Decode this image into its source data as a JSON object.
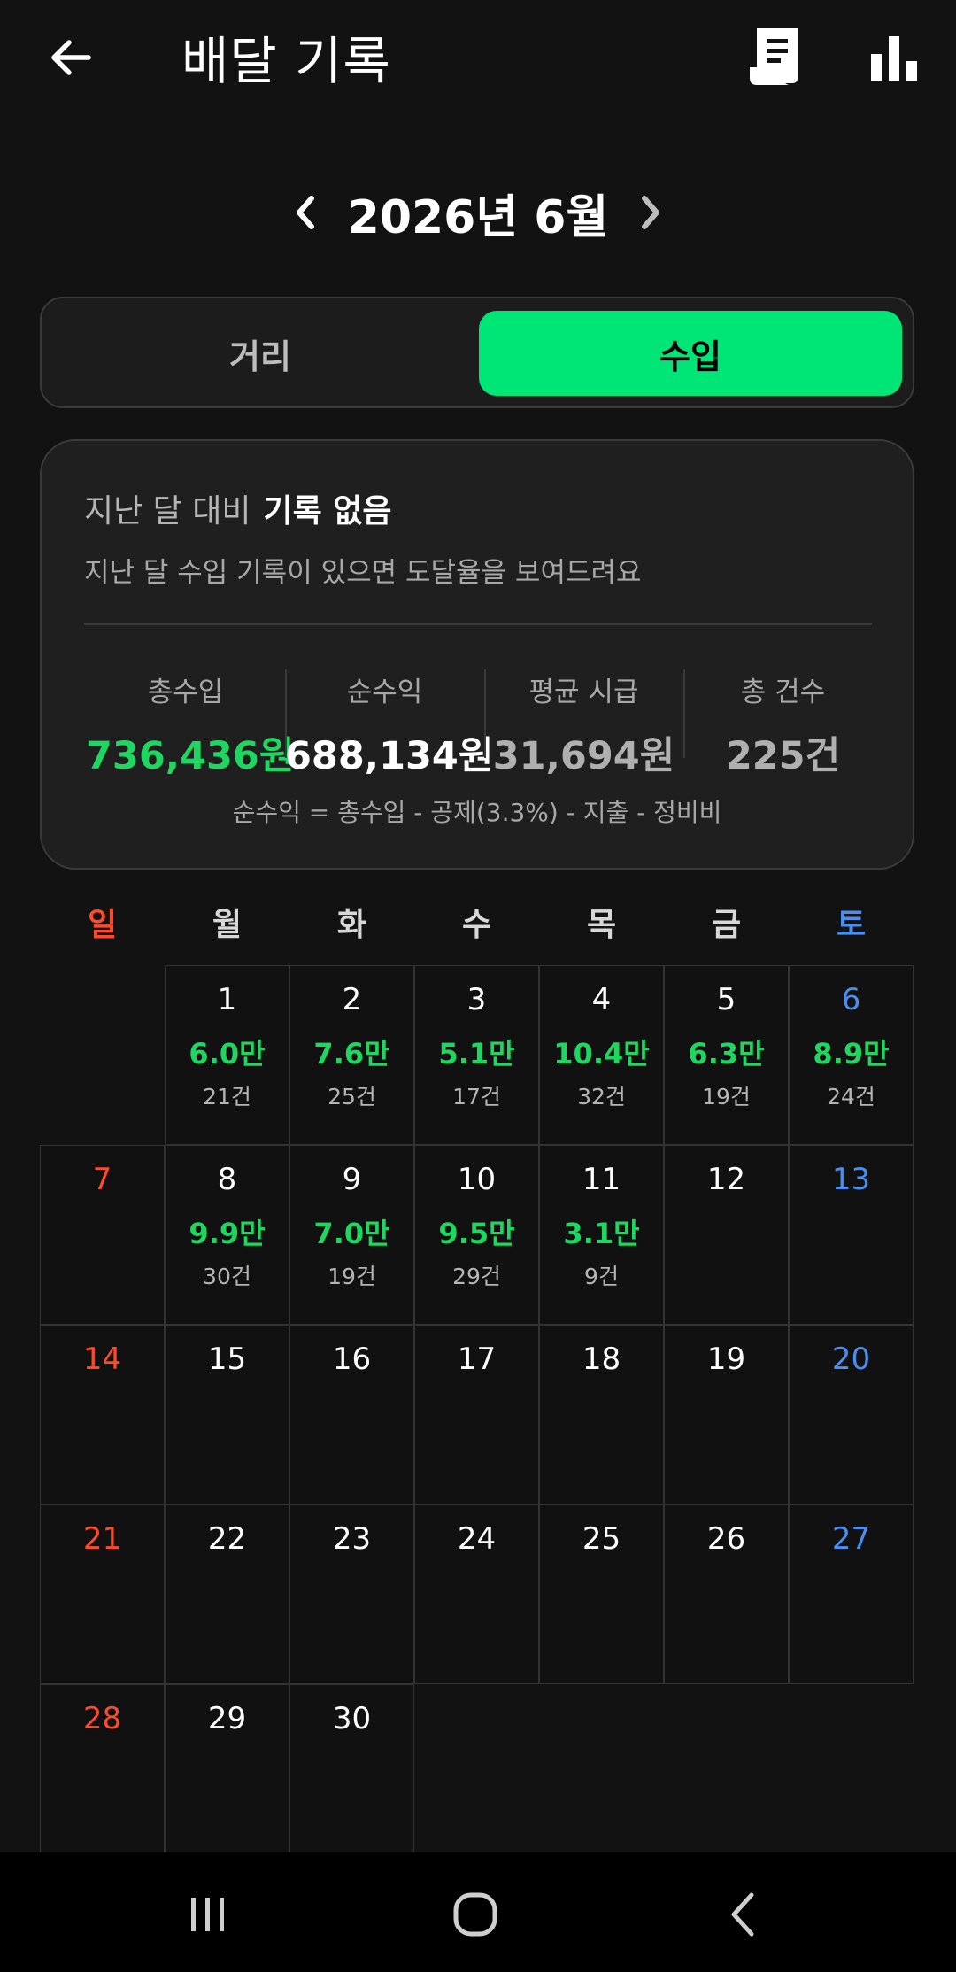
{
  "header": {
    "title": "배달 기록",
    "back_icon": "arrow-left-icon",
    "receipt_icon": "receipt-icon",
    "stats_icon": "bar-chart-icon"
  },
  "month_nav": {
    "label": "2026년 6월"
  },
  "toggle": {
    "distance_label": "거리",
    "income_label": "수입",
    "selected": "수입",
    "accent": "#00e676"
  },
  "summary": {
    "compare_prefix": "지난 달 대비",
    "compare_value": "기록 없음",
    "compare_desc": "지난 달 수입 기록이 있으면 도달율을 보여드려요",
    "stats": [
      {
        "label": "총수입",
        "value": "736,436원",
        "color": "#1ed760"
      },
      {
        "label": "순수익",
        "value": "688,134원",
        "color": "#ffffff"
      },
      {
        "label": "평균 시급",
        "value": "31,694원",
        "color": "#b0b0b0"
      },
      {
        "label": "총 건수",
        "value": "225건",
        "color": "#b0b0b0"
      }
    ],
    "formula": "순수익 = 총수입 - 공제(3.3%) - 지출 - 정비비"
  },
  "weekdays": [
    "일",
    "월",
    "화",
    "수",
    "목",
    "금",
    "토"
  ],
  "colors": {
    "sunday": "#ff4a2a",
    "saturday": "#4a8ef0",
    "income": "#1ed760"
  },
  "calendar": {
    "first_weekday_index": 1,
    "days": [
      {
        "day": "1",
        "amount": "6.0만",
        "count": "21건"
      },
      {
        "day": "2",
        "amount": "7.6만",
        "count": "25건"
      },
      {
        "day": "3",
        "amount": "5.1만",
        "count": "17건"
      },
      {
        "day": "4",
        "amount": "10.4만",
        "count": "32건"
      },
      {
        "day": "5",
        "amount": "6.3만",
        "count": "19건"
      },
      {
        "day": "6",
        "amount": "8.9만",
        "count": "24건"
      },
      {
        "day": "7",
        "amount": "",
        "count": ""
      },
      {
        "day": "8",
        "amount": "9.9만",
        "count": "30건"
      },
      {
        "day": "9",
        "amount": "7.0만",
        "count": "19건"
      },
      {
        "day": "10",
        "amount": "9.5만",
        "count": "29건"
      },
      {
        "day": "11",
        "amount": "3.1만",
        "count": "9건"
      },
      {
        "day": "12",
        "amount": "",
        "count": ""
      },
      {
        "day": "13",
        "amount": "",
        "count": ""
      },
      {
        "day": "14",
        "amount": "",
        "count": ""
      },
      {
        "day": "15",
        "amount": "",
        "count": ""
      },
      {
        "day": "16",
        "amount": "",
        "count": ""
      },
      {
        "day": "17",
        "amount": "",
        "count": ""
      },
      {
        "day": "18",
        "amount": "",
        "count": ""
      },
      {
        "day": "19",
        "amount": "",
        "count": ""
      },
      {
        "day": "20",
        "amount": "",
        "count": ""
      },
      {
        "day": "21",
        "amount": "",
        "count": ""
      },
      {
        "day": "22",
        "amount": "",
        "count": ""
      },
      {
        "day": "23",
        "amount": "",
        "count": ""
      },
      {
        "day": "24",
        "amount": "",
        "count": ""
      },
      {
        "day": "25",
        "amount": "",
        "count": ""
      },
      {
        "day": "26",
        "amount": "",
        "count": ""
      },
      {
        "day": "27",
        "amount": "",
        "count": ""
      },
      {
        "day": "28",
        "amount": "",
        "count": ""
      },
      {
        "day": "29",
        "amount": "",
        "count": ""
      },
      {
        "day": "30",
        "amount": "",
        "count": ""
      }
    ]
  },
  "system_nav": {
    "recents_icon": "recents-icon",
    "home_icon": "home-icon",
    "back_icon": "system-back-icon"
  }
}
